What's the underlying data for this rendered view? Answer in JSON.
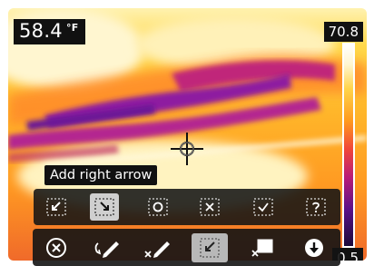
{
  "readout": {
    "value": "58.4",
    "unit": "°F"
  },
  "scale": {
    "max": "70.8",
    "min": "0.5"
  },
  "tooltip": {
    "label": "Add right arrow"
  },
  "arrow_options": [
    {
      "name": "arrow-down-left",
      "icon": "arrow-down-left-icon",
      "selected": false
    },
    {
      "name": "arrow-down-right",
      "icon": "arrow-down-right-icon",
      "selected": true
    },
    {
      "name": "circle-marker",
      "icon": "circle-icon",
      "selected": false
    },
    {
      "name": "x-marker",
      "icon": "x-icon",
      "selected": false
    },
    {
      "name": "check-marker",
      "icon": "check-icon",
      "selected": false
    },
    {
      "name": "question-marker",
      "icon": "question-icon",
      "selected": false
    }
  ],
  "tools": [
    {
      "name": "cancel",
      "icon": "cancel-circle-icon",
      "selected": false
    },
    {
      "name": "draw",
      "icon": "pen-icon",
      "selected": false
    },
    {
      "name": "erase",
      "icon": "eraser-pen-icon",
      "selected": false
    },
    {
      "name": "arrow-tool",
      "icon": "arrow-box-icon",
      "selected": true
    },
    {
      "name": "clear-box",
      "icon": "box-clear-icon",
      "selected": false
    },
    {
      "name": "save",
      "icon": "download-circle-icon",
      "selected": false
    }
  ],
  "colors": {
    "selected_button": "#cfcfcf",
    "toolbar": "#141414",
    "hot": "#fff6c8",
    "cold": "#6a1796"
  }
}
